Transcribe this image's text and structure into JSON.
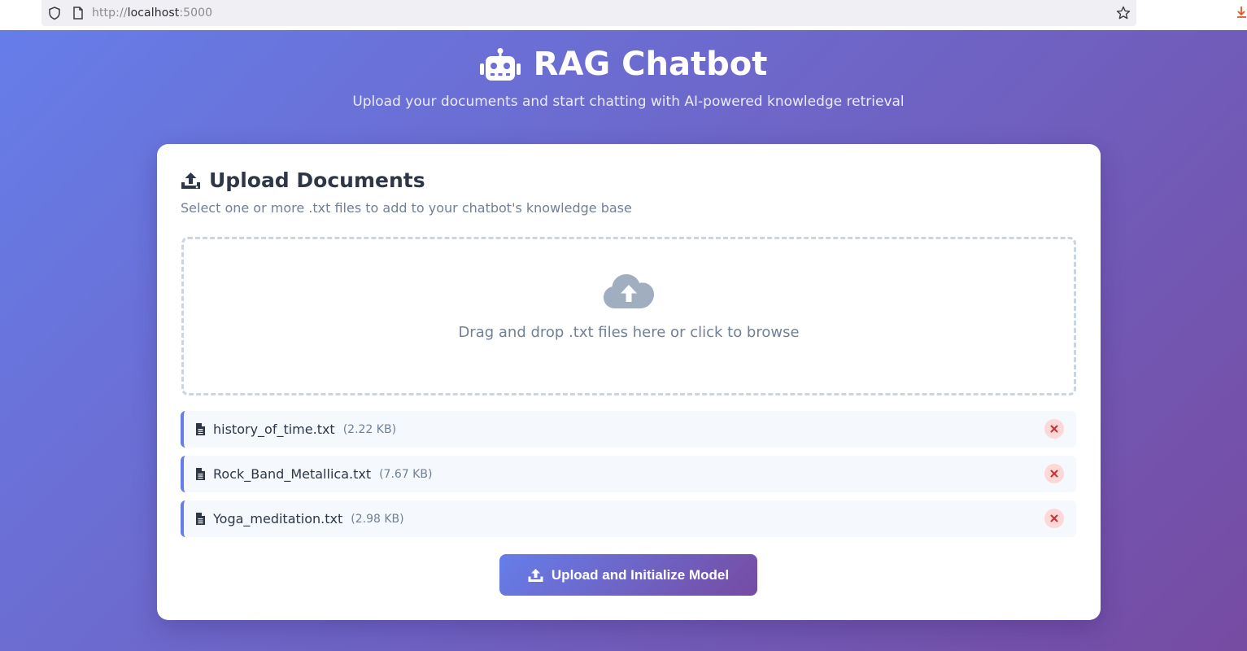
{
  "browser": {
    "url_scheme": "http://",
    "url_host": "localhost",
    "url_port": ":5000"
  },
  "header": {
    "title": "RAG Chatbot",
    "subtitle": "Upload your documents and start chatting with AI-powered knowledge retrieval",
    "icon": "robot-icon"
  },
  "upload_card": {
    "title": "Upload Documents",
    "description": "Select one or more .txt files to add to your chatbot's knowledge base",
    "dropzone_text": "Drag and drop .txt files here or click to browse",
    "files": [
      {
        "name": "history_of_time.txt",
        "size": "(2.22 KB)"
      },
      {
        "name": "Rock_Band_Metallica.txt",
        "size": "(7.67 KB)"
      },
      {
        "name": "Yoga_meditation.txt",
        "size": "(2.98 KB)"
      }
    ],
    "submit_label": "Upload and Initialize Model"
  },
  "colors": {
    "gradient_start": "#667eea",
    "gradient_end": "#764ba2",
    "remove_bg": "#fed7d7",
    "remove_icon": "#c53030"
  }
}
